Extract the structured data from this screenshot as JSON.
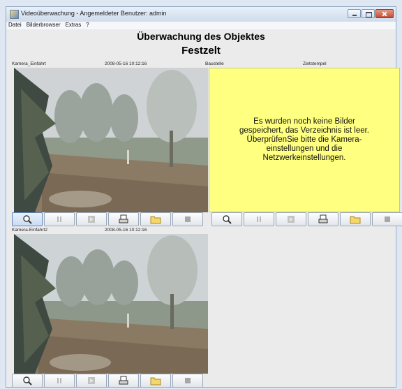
{
  "window": {
    "title": "Videoüberwachung - Angemeldeter Benutzer: admin",
    "menu": [
      "Datei",
      "Bilderbrowser",
      "Extras",
      "?"
    ]
  },
  "heading": {
    "line1": "Überwachung des Objektes",
    "line2": "Festzelt"
  },
  "cameras": [
    {
      "name": "Kamera_Einfahrt",
      "timestamp": "2008-05-16 10:12:16"
    },
    {
      "name": "Baustelle",
      "timestamp": "Zeitstempel",
      "empty_message": "Es wurden noch keine Bilder gespeichert, das Verzeichnis ist leer. ÜberprüfenSie bitte die Kamera-einstellungen und die Netzwerkeinstellungen."
    },
    {
      "name": "Kamera-Einfahrt2",
      "timestamp": "2008-05-16 10:12:16"
    }
  ],
  "toolbar_icons": [
    "zoom-icon",
    "pause-icon",
    "play-icon",
    "print-icon",
    "folder-icon",
    "stop-icon"
  ],
  "colors": {
    "empty_panel": "#ffff80",
    "window_border": "#8ea6c1"
  }
}
